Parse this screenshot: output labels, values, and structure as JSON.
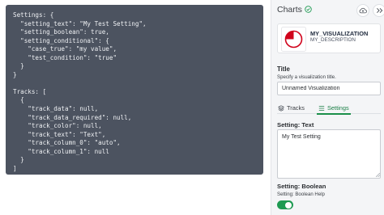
{
  "code": {
    "lines": [
      "Settings: {",
      "  \"setting_text\": \"My Test Setting\",",
      "  \"setting_boolean\": true,",
      "  \"setting_conditional\": {",
      "    \"case_true\": \"my value\",",
      "    \"test_condition\": \"true\"",
      "  }",
      "}",
      "",
      "Tracks: [",
      "  {",
      "    \"track_data\": null,",
      "    \"track_data_required\": null,",
      "    \"track_color\": null,",
      "    \"track_text\": \"Text\",",
      "    \"track_column_0\": \"auto\",",
      "    \"track_column_1\": null",
      "  }",
      "]"
    ]
  },
  "header": {
    "title": "Charts",
    "check_icon": "check-circle-icon",
    "cloud_icon": "cloud-upload-icon",
    "expand_icon": "chevrons-right-icon"
  },
  "visualization": {
    "name": "MY_VISUALIZATION",
    "description": "MY_DESCRIPTION",
    "thumb_icon": "pie-chart-icon",
    "accent_color": "#d0021b"
  },
  "title_setting": {
    "label": "Title",
    "help": "Specify a visualization title.",
    "value": "Unnamed Visualization"
  },
  "tabs": [
    {
      "label": "Tracks",
      "icon": "layers-icon",
      "active": false
    },
    {
      "label": "Settings",
      "icon": "list-icon",
      "active": true
    }
  ],
  "text_setting": {
    "label": "Setting: Text",
    "value": "My Test Setting"
  },
  "boolean_setting": {
    "label": "Setting: Boolean",
    "help": "Setting: Boolean Help",
    "value": true
  },
  "colors": {
    "accent_green": "#1e9a52",
    "code_bg": "#4c5360"
  }
}
